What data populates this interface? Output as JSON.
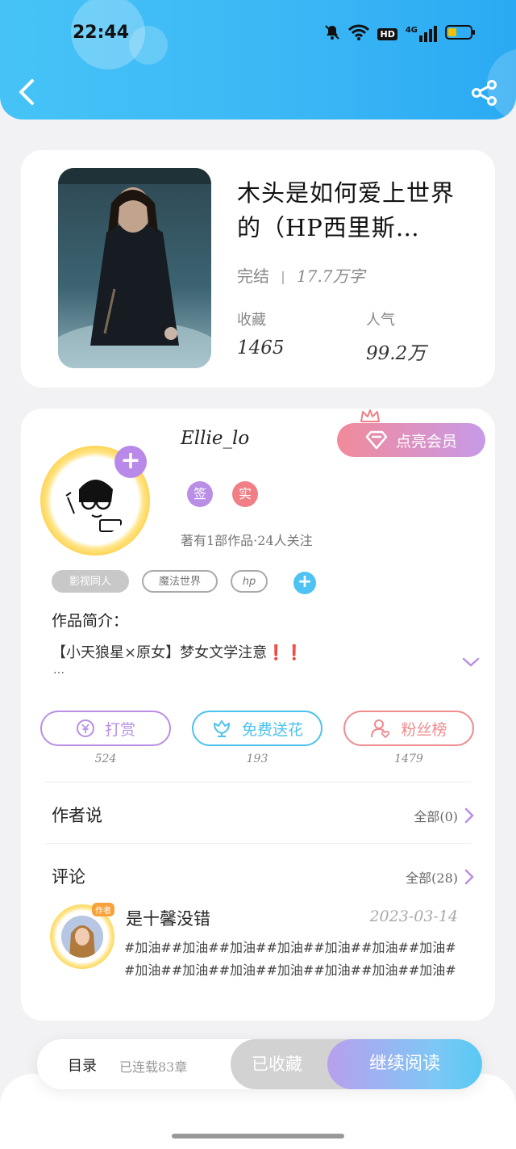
{
  "status_bar": {
    "time": "22:44",
    "network_label": "4G",
    "hd_label": "HD"
  },
  "book": {
    "title": "木头是如何爱上世界的（HP西里斯…",
    "status": "完结",
    "word_count": "17.7万字",
    "stats": [
      {
        "label": "收藏",
        "value": "1465"
      },
      {
        "label": "人气",
        "value": "99.2万"
      }
    ]
  },
  "author": {
    "name": "Ellie_lo",
    "vip_label": "点亮会员",
    "badges": [
      {
        "label": "签",
        "color": "#b98fe6"
      },
      {
        "label": "实",
        "color": "#f07f86"
      }
    ],
    "meta": "著有1部作品·24人关注"
  },
  "tags": [
    "影视同人",
    "魔法世界",
    "hp"
  ],
  "intro": {
    "title": "作品简介：",
    "text": "【小天狼星×原女】梦女文学注意❗❗",
    "more": "…"
  },
  "actions": [
    {
      "label": "打赏",
      "count": "524",
      "color": "#b98fe6"
    },
    {
      "label": "免费送花",
      "count": "193",
      "color": "#4cc2ee"
    },
    {
      "label": "粉丝榜",
      "count": "1479",
      "color": "#ee8b8e"
    }
  ],
  "author_says": {
    "title": "作者说",
    "link": "全部(0)"
  },
  "comments": {
    "title": "评论",
    "link": "全部(28)",
    "items": [
      {
        "name": "是十馨没错",
        "date": "2023-03-14",
        "badge": "作者",
        "text": "#加油##加油##加油##加油##加油##加油##加油##加油##加油##加油##加油##加油##加油##加油#"
      }
    ]
  },
  "bottom_bar": {
    "toc_label": "目录",
    "chapter_count": "已连载83章",
    "fav_label": "已收藏",
    "read_label": "继续阅读"
  },
  "colors": {
    "header": "#3ab6f5",
    "accent_blue": "#4ec3f3",
    "accent_purple": "#b889e9"
  }
}
